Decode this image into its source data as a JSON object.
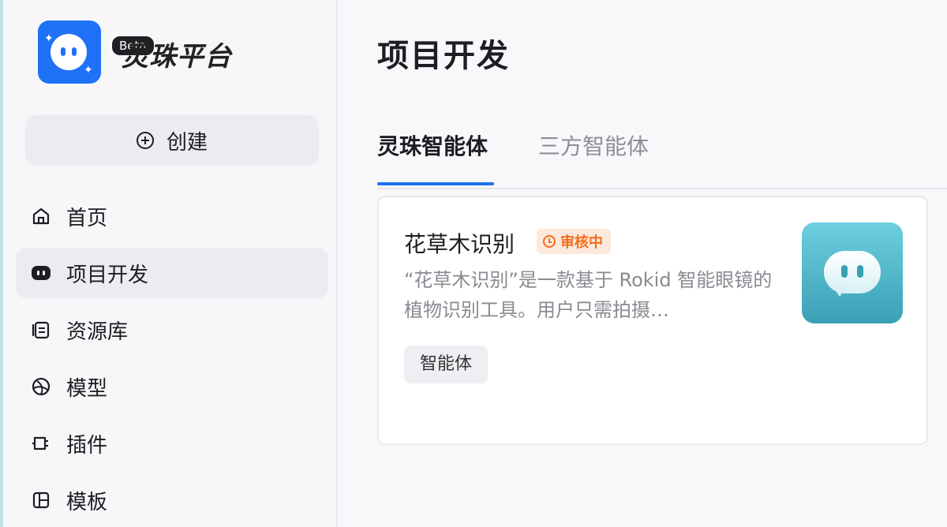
{
  "sidebar": {
    "brand": "灵珠平台",
    "beta": "Beta",
    "create_label": "创建",
    "items": [
      {
        "label": "首页",
        "icon": "home-icon"
      },
      {
        "label": "项目开发",
        "icon": "robot-icon"
      },
      {
        "label": "资源库",
        "icon": "library-icon"
      },
      {
        "label": "模型",
        "icon": "model-icon"
      },
      {
        "label": "插件",
        "icon": "plugin-icon"
      },
      {
        "label": "模板",
        "icon": "template-icon"
      }
    ],
    "active_item": "项目开发"
  },
  "main": {
    "title": "项目开发",
    "tabs": [
      {
        "label": "灵珠智能体",
        "active": true
      },
      {
        "label": "三方智能体",
        "active": false
      }
    ],
    "cards": [
      {
        "title": "花草木识别",
        "status": "审核中",
        "description": "“花草木识别”是一款基于 Rokid 智能眼镜的植物识别工具。用户只需拍摄…",
        "tag": "智能体"
      }
    ]
  },
  "colors": {
    "accent": "#1f6ff0",
    "status": "#f26c1d",
    "status_bg": "#fde8dc"
  }
}
